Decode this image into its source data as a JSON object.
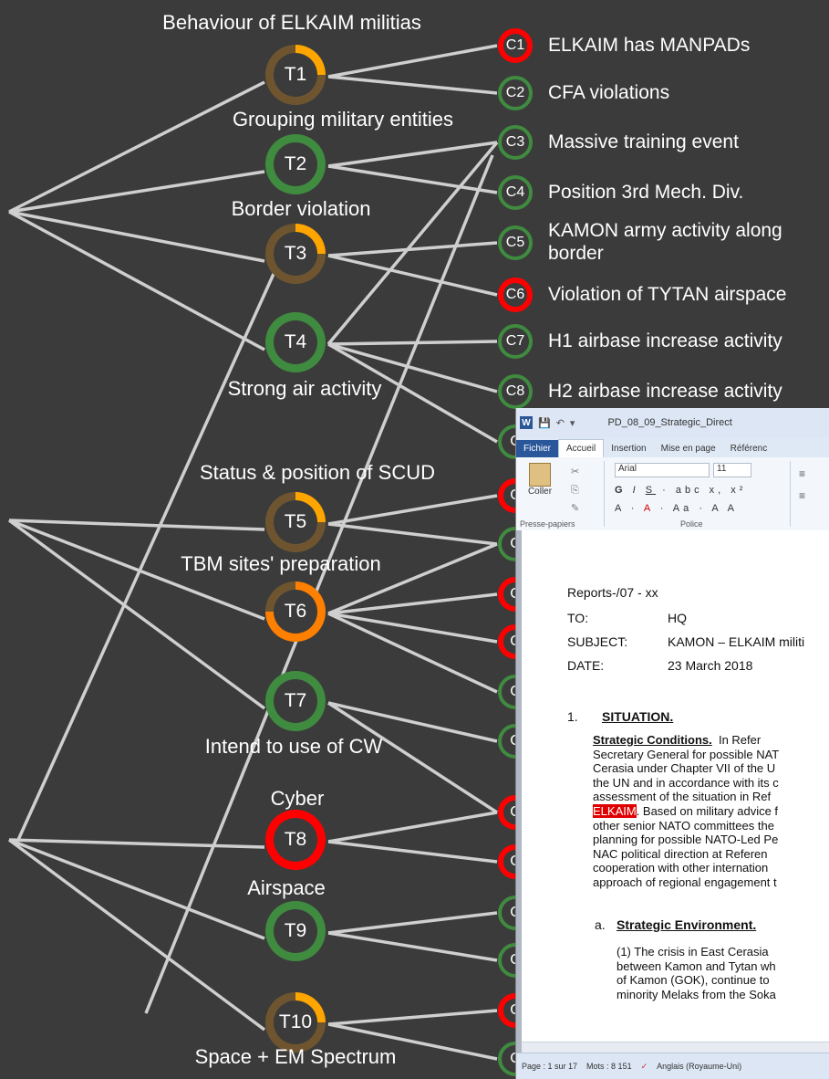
{
  "colors": {
    "background": "#3b3b3b",
    "edge": "#cfcfcf",
    "green": "#3f8b3f",
    "brown": "#6e5530",
    "orange": "#ffa500",
    "dark_orange": "#ff7f00",
    "red": "#ff0000"
  },
  "threats": [
    {
      "id": "T1",
      "label": "Behaviour of ELKAIM militias",
      "fill": 0.25,
      "fill_color": "orange",
      "base": "brown"
    },
    {
      "id": "T2",
      "label": "Grouping military entities",
      "fill": 0,
      "base": "green"
    },
    {
      "id": "T3",
      "label": "Border violation",
      "fill": 0.25,
      "fill_color": "orange",
      "base": "brown"
    },
    {
      "id": "T4",
      "label": "Strong air activity",
      "fill": 0,
      "base": "green"
    },
    {
      "id": "T5",
      "label": "Status & position of SCUD",
      "fill": 0.25,
      "fill_color": "orange",
      "base": "brown"
    },
    {
      "id": "T6",
      "label": "TBM sites' preparation",
      "fill": 0.75,
      "fill_color": "dark_orange",
      "base": "brown"
    },
    {
      "id": "T7",
      "label": "Intend to use of CW",
      "fill": 0,
      "base": "green"
    },
    {
      "id": "T8",
      "label": "Cyber",
      "fill": 1,
      "fill_color": "red",
      "base": "red"
    },
    {
      "id": "T9",
      "label": "Airspace",
      "fill": 0,
      "base": "green"
    },
    {
      "id": "T10",
      "label": "Space + EM Spectrum",
      "fill": 0.25,
      "fill_color": "orange",
      "base": "brown"
    }
  ],
  "criteria": [
    {
      "id": "C1",
      "label": "ELKAIM has MANPADs",
      "status": "red"
    },
    {
      "id": "C2",
      "label": "CFA violations",
      "status": "green"
    },
    {
      "id": "C3",
      "label": "Massive training event",
      "status": "green"
    },
    {
      "id": "C4",
      "label": "Position 3rd Mech. Div.",
      "status": "green"
    },
    {
      "id": "C5",
      "label": "KAMON army activity along border",
      "status": "green"
    },
    {
      "id": "C6",
      "label": "Violation of TYTAN airspace",
      "status": "red"
    },
    {
      "id": "C7",
      "label": "H1 airbase increase activity",
      "status": "green"
    },
    {
      "id": "C8",
      "label": "H2 airbase increase activity",
      "status": "green"
    },
    {
      "id": "C",
      "label": "",
      "status": "green"
    },
    {
      "id": "C",
      "label": "",
      "status": "red"
    },
    {
      "id": "C",
      "label": "",
      "status": "green"
    },
    {
      "id": "C",
      "label": "",
      "status": "red"
    },
    {
      "id": "C",
      "label": "",
      "status": "red"
    },
    {
      "id": "C",
      "label": "",
      "status": "green"
    },
    {
      "id": "C",
      "label": "",
      "status": "green"
    },
    {
      "id": "C",
      "label": "",
      "status": "red"
    },
    {
      "id": "C",
      "label": "",
      "status": "red"
    },
    {
      "id": "C",
      "label": "",
      "status": "green"
    },
    {
      "id": "C",
      "label": "",
      "status": "green"
    },
    {
      "id": "C",
      "label": "",
      "status": "red"
    },
    {
      "id": "C",
      "label": "",
      "status": "green"
    }
  ],
  "word": {
    "app_icon": "W",
    "title": "PD_08_09_Strategic_Direct",
    "tabs": [
      "Fichier",
      "Accueil",
      "Insertion",
      "Mise en page",
      "Référenc"
    ],
    "font_name": "Arial",
    "font_size": "11",
    "paste_label": "Coller",
    "groups": [
      "Presse-papiers",
      "Police"
    ],
    "doc": {
      "ref": "Reports-/07 - xx",
      "to_label": "TO:",
      "to_value": "HQ",
      "subject_label": "SUBJECT:",
      "subject_value": "KAMON – ELKAIM militi",
      "date_label": "DATE:",
      "date_value": "23 March 2018",
      "section_num": "1.",
      "section_title": "SITUATION.",
      "para1_heading": "Strategic Conditions.",
      "para1_lines": [
        "In Refer",
        "Secretary General for possible NAT",
        "Cerasia under Chapter VII of the U",
        "the UN and in accordance with its c",
        "assessment of the situation in Ref"
      ],
      "para1_highlight": "ELKAIM",
      "para1_after": ". Based on military advice f",
      "para1_rest": [
        "other senior NATO committees the",
        "planning for possible NATO-Led Pe",
        "NAC political direction at Referen",
        "cooperation with other internation",
        "approach of regional engagement t"
      ],
      "sub_label": "a.",
      "sub_title": "Strategic Environment.",
      "para2_lines": [
        "(1) The crisis in East Cerasia",
        "between Kamon and Tytan wh",
        "of Kamon (GOK), continue to",
        "minority Melaks from the Soka"
      ]
    },
    "status": {
      "page": "Page : 1 sur 17",
      "words": "Mots : 8 151",
      "language": "Anglais (Royaume-Uni)"
    }
  }
}
